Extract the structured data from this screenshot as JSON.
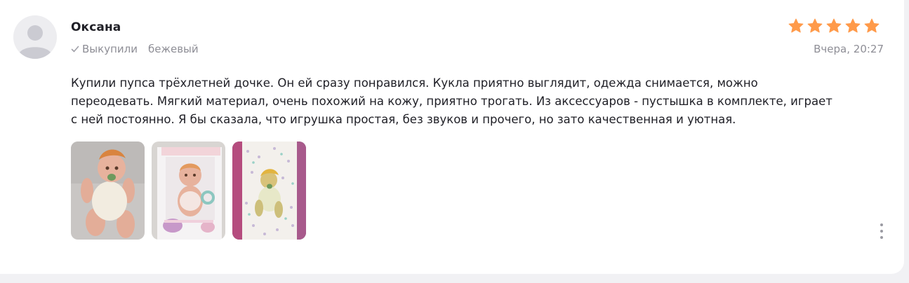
{
  "review": {
    "author": "Оксана",
    "purchased_label": "Выкупили",
    "variant": "бежевый",
    "date": "Вчера, 20:27",
    "rating": 5,
    "rating_max": 5,
    "star_color": "#ff9a4a",
    "text": "Купили пупса трёхлетней дочке. Он ей сразу понравился. Кукла приятно выглядит, одежда снимается, можно переодевать. Мягкий материал, очень похожий на кожу, приятно трогать. Из аксессуаров - пустышка в комплекте, играет с ней постоянно. Я бы сказала, что игрушка простая, без звуков и прочего, но зато качественная и уютная.",
    "photos": [
      {
        "icon": "doll-photo-1"
      },
      {
        "icon": "doll-box-photo"
      },
      {
        "icon": "doll-stroller-photo"
      }
    ]
  },
  "icons": {
    "avatar": "user-avatar-icon",
    "purchased": "checkmark-icon",
    "star": "star-icon",
    "more": "more-vertical-icon"
  }
}
